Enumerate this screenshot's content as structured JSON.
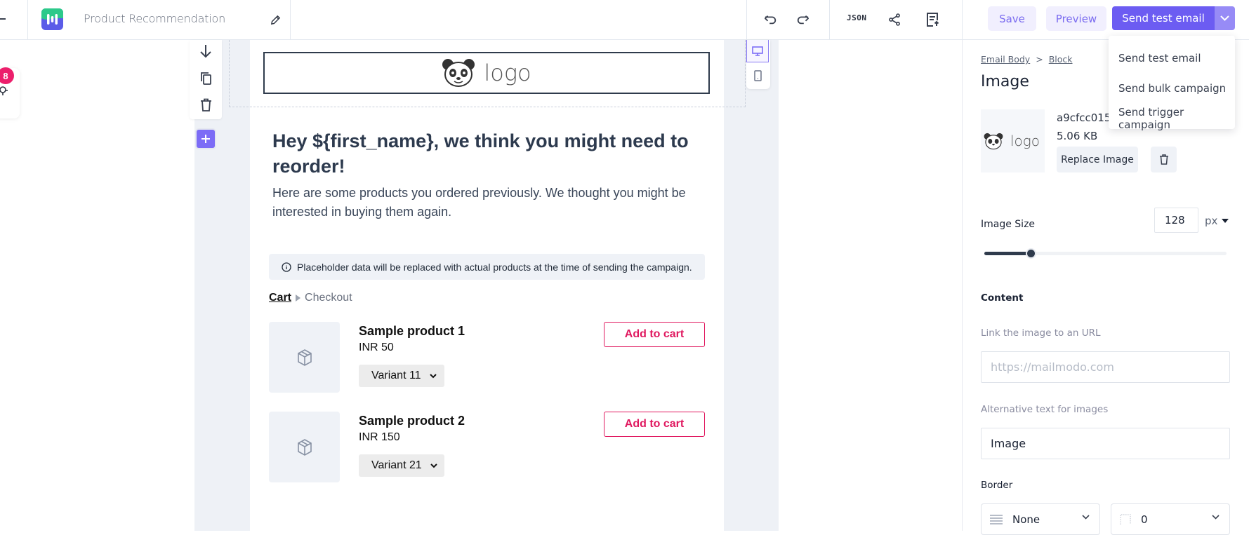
{
  "header": {
    "campaign_title": "Product Recommendation",
    "json_label": "JSON",
    "save_label": "Save",
    "preview_label": "Preview",
    "send_test_label": "Send test email"
  },
  "send_menu": {
    "items": [
      {
        "label": "Send test email"
      },
      {
        "label": "Send bulk campaign"
      },
      {
        "label": "Send trigger campaign"
      }
    ]
  },
  "left_panel": {
    "badge_count": "8"
  },
  "email": {
    "logo_text": "logo",
    "heading": "Hey ${first_name}, we think you might need to reorder!",
    "subtext": "Here are some products you ordered previously. We thought you might be interested in buying them again.",
    "notice": "Placeholder data will be replaced with actual products at the time of sending the campaign.",
    "breadcrumb": {
      "current": "Cart",
      "next": "Checkout"
    },
    "products": [
      {
        "name": "Sample product 1",
        "price": "INR 50",
        "variant": "Variant 11",
        "cta": "Add to cart"
      },
      {
        "name": "Sample product 2",
        "price": "INR 150",
        "variant": "Variant 21",
        "cta": "Add to cart"
      }
    ]
  },
  "properties": {
    "breadcrumb": [
      "Email Body",
      "Block"
    ],
    "breadcrumb_sep": ">",
    "title": "Image",
    "thumb_logo_text": "logo",
    "file_name": "a9cfcc015",
    "file_size": "5.06 KB",
    "replace_label": "Replace Image",
    "image_size_label": "Image Size",
    "image_size_value": "128",
    "image_size_unit": "px",
    "image_size_slider_fraction": 0.19,
    "content_label": "Content",
    "link_label": "Link the image to an URL",
    "link_placeholder": "https://mailmodo.com",
    "link_value": "",
    "alt_label": "Alternative text for images",
    "alt_value": "Image",
    "border_label": "Border",
    "border_style": "None",
    "border_width": "0"
  },
  "colors": {
    "accent": "#6c5cf2",
    "accent_light": "#f1effe",
    "cta_pink": "#e0185f",
    "badge": "#ec1f6c"
  }
}
